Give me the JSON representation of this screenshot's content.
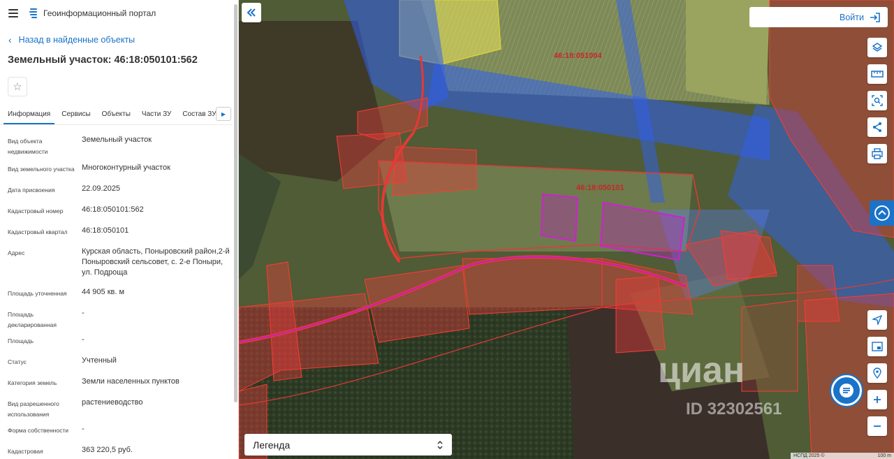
{
  "header": {
    "title": "Геоинформационный портал"
  },
  "back_label": "Назад в найденные объекты",
  "page_title": "Земельный участок: 46:18:050101:562",
  "tabs": [
    "Информация",
    "Сервисы",
    "Объекты",
    "Части ЗУ",
    "Состав ЗУ"
  ],
  "properties": [
    {
      "label": "Вид объекта недвижимости",
      "value": "Земельный участок"
    },
    {
      "label": "Вид земельного участка",
      "value": "Многоконтурный участок"
    },
    {
      "label": "Дата присвоения",
      "value": "22.09.2025"
    },
    {
      "label": "Кадастровый номер",
      "value": "46:18:050101:562"
    },
    {
      "label": "Кадастровый квартал",
      "value": "46:18:050101"
    },
    {
      "label": "Адрес",
      "value": "Курская область, Поныровский район,2-й Поныровский сельсовет, с. 2-е Поныри, ул. Подроща"
    },
    {
      "label": "Площадь уточненная",
      "value": "44 905 кв. м"
    },
    {
      "label": "Площадь декларированная",
      "value": "-"
    },
    {
      "label": "Площадь",
      "value": "-"
    },
    {
      "label": "Статус",
      "value": "Учтенный"
    },
    {
      "label": "Категория земель",
      "value": "Земли населенных пунктов"
    },
    {
      "label": "Вид разрешенного использования",
      "value": "растениеводство"
    },
    {
      "label": "Форма собственности",
      "value": "-"
    },
    {
      "label": "Кадастровая",
      "value": "363 220,5 руб."
    }
  ],
  "map": {
    "login_label": "Войти",
    "legend_label": "Легенда",
    "parcel_labels": [
      "46:18:051004",
      "46:18:050101"
    ],
    "attribution": "НСПД 2025 ©",
    "scale_label": "100 m",
    "watermark": "циан",
    "watermark_id": "ID 32302561"
  },
  "colors": {
    "accent": "#1a73c8",
    "parcel_red": "#e53935",
    "highlight_magenta": "#c020c0",
    "overlay_blue": "#2f5ff0"
  }
}
